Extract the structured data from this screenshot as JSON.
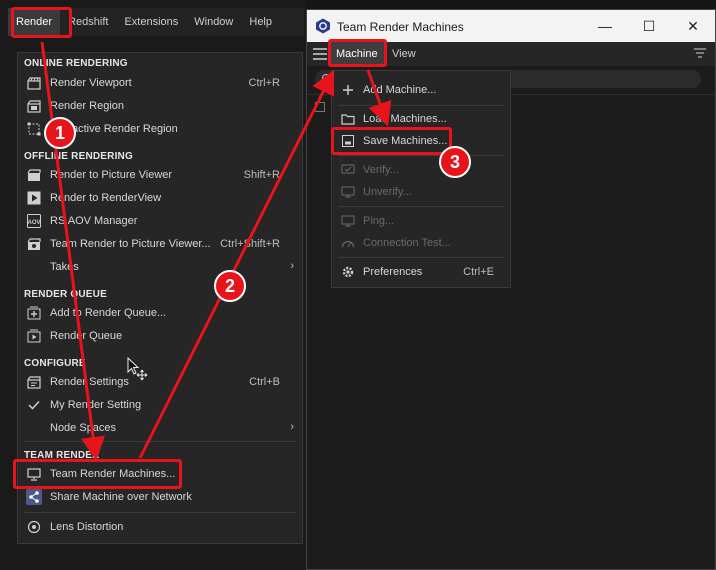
{
  "main_menubar": {
    "items": [
      "Render",
      "Redshift",
      "Extensions",
      "Window",
      "Help"
    ],
    "active": "Render"
  },
  "render_menu": {
    "sections": {
      "online": "ONLINE RENDERING",
      "offline": "OFFLINE RENDERING",
      "queue": "RENDER QUEUE",
      "configure": "CONFIGURE",
      "team": "TEAM RENDER"
    },
    "items": {
      "render_viewport": {
        "label": "Render Viewport",
        "shortcut": "Ctrl+R"
      },
      "render_region": {
        "label": "Render Region"
      },
      "interactive_render_region": {
        "label": "Interactive Render Region"
      },
      "render_to_picture_viewer": {
        "label": "Render to Picture Viewer",
        "shortcut": "Shift+R"
      },
      "render_to_renderview": {
        "label": "Render to RenderView"
      },
      "rs_aov_manager": {
        "label": "RS AOV Manager"
      },
      "team_render_to_pv": {
        "label": "Team Render to Picture Viewer...",
        "shortcut": "Ctrl+Shift+R"
      },
      "takes": {
        "label": "Takes"
      },
      "add_to_queue": {
        "label": "Add to Render Queue..."
      },
      "render_queue": {
        "label": "Render Queue"
      },
      "render_settings": {
        "label": "Render Settings",
        "shortcut": "Ctrl+B"
      },
      "my_render_setting": {
        "label": "My Render Setting"
      },
      "node_spaces": {
        "label": "Node Spaces"
      },
      "team_render_machines": {
        "label": "Team Render Machines..."
      },
      "share_machine": {
        "label": "Share Machine over Network"
      },
      "lens_distortion": {
        "label": "Lens Distortion"
      }
    }
  },
  "team_render_window": {
    "title": "Team Render Machines",
    "window_controls": {
      "minimize": "—",
      "maximize": "☐",
      "close": "✕"
    },
    "menus": [
      "Machine",
      "View"
    ],
    "active_menu": "Machine"
  },
  "machine_menu": {
    "add": {
      "label": "Add Machine..."
    },
    "load": {
      "label": "Load Machines..."
    },
    "save": {
      "label": "Save Machines..."
    },
    "verify": {
      "label": "Verify..."
    },
    "unverify": {
      "label": "Unverify..."
    },
    "ping": {
      "label": "Ping..."
    },
    "connection_test": {
      "label": "Connection Test..."
    },
    "preferences": {
      "label": "Preferences",
      "shortcut": "Ctrl+E"
    }
  },
  "annotations": {
    "steps": [
      "1",
      "2",
      "3"
    ],
    "color": "#e8141c"
  },
  "colors": {
    "menu_bg": "#262626",
    "title_bar": "#f3f3f3",
    "accent_red": "#e8141c"
  }
}
